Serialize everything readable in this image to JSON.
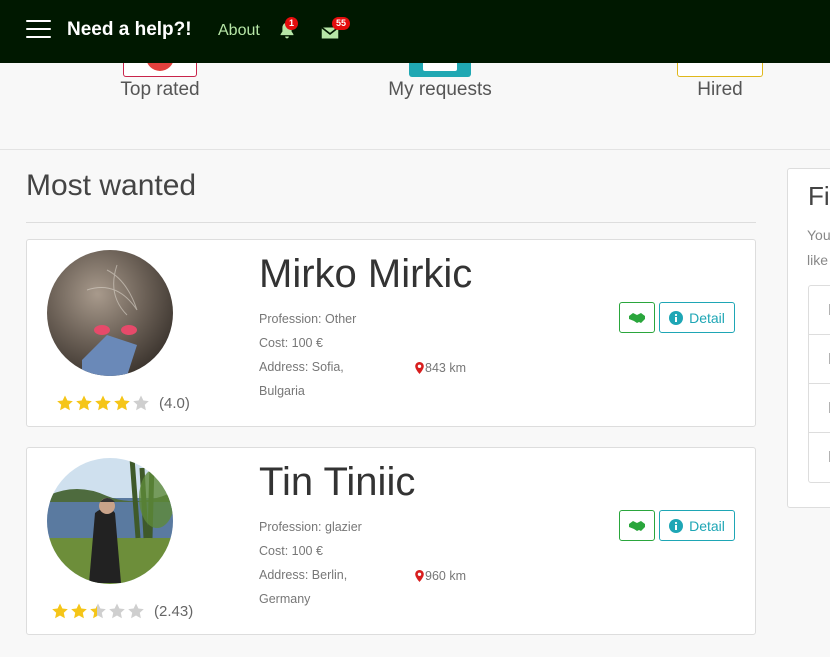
{
  "navbar": {
    "brand": "Need a help?!",
    "about": "About",
    "notifications_count": "1",
    "messages_count": "55"
  },
  "categories": [
    {
      "label": "Top rated"
    },
    {
      "label": "My requests"
    },
    {
      "label": "Hired"
    }
  ],
  "section": {
    "title": "Most wanted"
  },
  "profiles": [
    {
      "name": "Mirko Mirkic",
      "profession": "Profession: Other",
      "cost": "Cost: 100 €",
      "address_line1": "Address: Sofia,",
      "address_line2": "Bulgaria",
      "distance": "843 km",
      "rating": 4.0,
      "rating_label": "(4.0)",
      "detail_label": "Detail"
    },
    {
      "name": "Tin Tiniic",
      "profession": "Profession: glazier",
      "cost": "Cost: 100 €",
      "address_line1": "Address: Berlin,",
      "address_line2": "Germany",
      "distance": "960 km",
      "rating": 2.43,
      "rating_label": "(2.43)",
      "detail_label": "Detail"
    }
  ],
  "filter": {
    "title_partial": "Fi",
    "text_line1": "You",
    "text_line2": "like"
  },
  "colors": {
    "navbar_bg": "#001800",
    "star": "#f5c518",
    "hire": "#2aa63c",
    "detail": "#1ea6b5",
    "badge": "#e40d0d"
  },
  "icons": [
    "hamburger-icon",
    "bell-icon",
    "envelope-icon",
    "star-icon",
    "map-pin-icon",
    "handshake-icon",
    "info-icon"
  ]
}
